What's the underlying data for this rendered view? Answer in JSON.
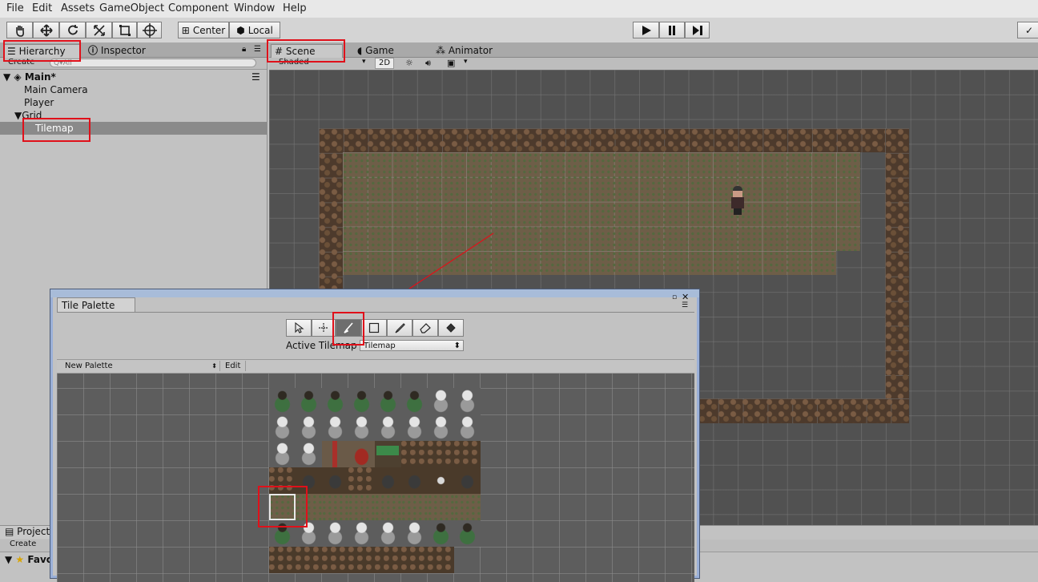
{
  "menu": [
    "File",
    "Edit",
    "Assets",
    "GameObject",
    "Component",
    "Window",
    "Help"
  ],
  "toolbar": {
    "tools": [
      "hand-icon",
      "move-icon",
      "rotate-icon",
      "scale-icon",
      "rect-icon",
      "transform-icon"
    ],
    "pivot_label": "Center",
    "space_label": "Local",
    "play": [
      "play-icon",
      "pause-icon",
      "step-icon"
    ]
  },
  "hierarchy": {
    "tab_label": "Hierarchy",
    "inspector_label": "Inspector",
    "create_label": "Create",
    "search_placeholder": "Q▾All",
    "scene_name": "Main*",
    "items": [
      "Main Camera",
      "Player",
      "Grid",
      "Tilemap"
    ]
  },
  "scene": {
    "tabs": [
      "Scene",
      "Game",
      "Animator"
    ],
    "shading": "Shaded",
    "mode_2d": "2D"
  },
  "palette": {
    "title": "Tile Palette",
    "active_tilemap_label": "Active Tilemap",
    "active_tilemap_value": "Tilemap",
    "palette_name": "New Palette",
    "edit_label": "Edit",
    "tools": [
      "select-icon",
      "move-icon",
      "brush-icon",
      "box-fill-icon",
      "picker-icon",
      "eraser-icon",
      "fill-icon"
    ],
    "tile_rows": [
      [
        "zombie-green",
        "zombie-green",
        "zombie-green",
        "zombie-green",
        "zombie-green",
        "zombie-green",
        "skeleton",
        "skeleton"
      ],
      [
        "skeleton",
        "skeleton",
        "skeleton",
        "skeleton",
        "skeleton",
        "skeleton",
        "skeleton",
        "skeleton"
      ],
      [
        "skeleton",
        "skeleton",
        "bottle",
        "meat",
        "exit-sign",
        "wall",
        "wall",
        "wall"
      ],
      [
        "wall",
        "rock",
        "rock",
        "wall",
        "rock",
        "rock",
        "skull",
        "rock"
      ],
      [
        "floor",
        "floor",
        "floor",
        "floor",
        "floor",
        "floor",
        "floor",
        "floor"
      ],
      [
        "zombie-green",
        "skeleton",
        "skeleton",
        "skeleton",
        "skeleton",
        "skeleton",
        "zombie-green",
        "zombie-green"
      ],
      [
        "wall",
        "wall",
        "wall",
        "wall",
        "wall",
        "wall",
        "wall",
        ""
      ]
    ]
  },
  "project": {
    "tab_label": "Project",
    "create_label": "Create",
    "favorites_label": "Favo"
  },
  "colors": {
    "highlight": "#e0101a",
    "selection": "#8a8a8a"
  }
}
